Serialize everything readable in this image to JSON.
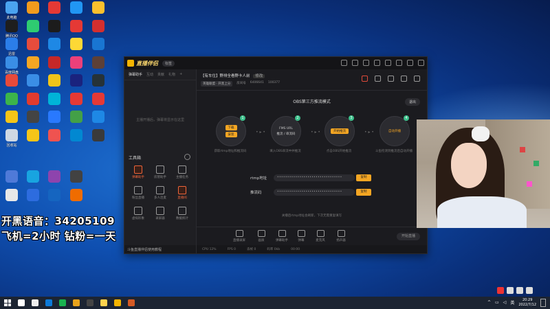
{
  "desktop": {
    "icons": [
      {
        "label": "此电脑",
        "color": "#4aa3f0"
      },
      {
        "label": "腾讯QQ",
        "color": "#1e1e1e"
      },
      {
        "label": "迅雷",
        "color": "#2b7de9"
      },
      {
        "label": "百度网盘",
        "color": "#3a8ee6"
      },
      {
        "label": "",
        "color": "#e84a3a"
      },
      {
        "label": "",
        "color": "#3cb44b"
      },
      {
        "label": "",
        "color": "#f5c518"
      },
      {
        "label": "回收站",
        "color": "#cfd8e3"
      },
      {
        "label": "",
        "color": "#4f7ad8"
      },
      {
        "label": "",
        "color": "#e8e8e8"
      },
      {
        "label": "",
        "color": "#f29b1d"
      },
      {
        "label": "",
        "color": "#2ecc71"
      },
      {
        "label": "",
        "color": "#e74c3c"
      },
      {
        "label": "",
        "color": "#f5a623"
      },
      {
        "label": "",
        "color": "#3a8ee6"
      },
      {
        "label": "",
        "color": "#e23b2e"
      },
      {
        "label": "",
        "color": "#444"
      },
      {
        "label": "",
        "color": "#f5c518"
      },
      {
        "label": "",
        "color": "#18a4e0"
      },
      {
        "label": "",
        "color": "#2d6cdf"
      },
      {
        "label": "",
        "color": "#e53935"
      },
      {
        "label": "",
        "color": "#1c1c1c"
      },
      {
        "label": "",
        "color": "#1e88e5"
      },
      {
        "label": "",
        "color": "#c62828"
      },
      {
        "label": "",
        "color": "#f0c419"
      },
      {
        "label": "",
        "color": "#00b4d8"
      },
      {
        "label": "",
        "color": "#2979ff"
      },
      {
        "label": "",
        "color": "#ef5350"
      },
      {
        "label": "",
        "color": "#8e44ad"
      },
      {
        "label": "",
        "color": "#1565c0"
      },
      {
        "label": "",
        "color": "#2196f3"
      },
      {
        "label": "",
        "color": "#e53935"
      },
      {
        "label": "",
        "color": "#fdd835"
      },
      {
        "label": "",
        "color": "#ec407a"
      },
      {
        "label": "",
        "color": "#1a237e"
      },
      {
        "label": "",
        "color": "#e53935"
      },
      {
        "label": "",
        "color": "#43a047"
      },
      {
        "label": "",
        "color": "#0288d1"
      },
      {
        "label": "",
        "color": "#424242"
      },
      {
        "label": "",
        "color": "#ef6c00"
      },
      {
        "label": "",
        "color": "#fbc02d"
      },
      {
        "label": "",
        "color": "#d32f2f"
      },
      {
        "label": "",
        "color": "#1976d2"
      },
      {
        "label": "",
        "color": "#5d4037"
      },
      {
        "label": "",
        "color": "#263238"
      },
      {
        "label": "",
        "color": "#e53935"
      },
      {
        "label": "",
        "color": "#1e88e5"
      },
      {
        "label": "",
        "color": "#3a3a3a"
      }
    ]
  },
  "overlay": {
    "line1": "开黑语音：34205109",
    "line2": "飞机=2小时 钻粉=一天"
  },
  "window": {
    "app_name": "直播伴侣",
    "version": "标签",
    "left_tabs": [
      "弹幕助手",
      "互动",
      "贡献",
      "礼物",
      "+"
    ],
    "left_hint": "主播开播后，弹幕将显示在这里",
    "tools_title": "工具箱",
    "tools": [
      {
        "label": "弹幕助手",
        "orange": true
      },
      {
        "label": "房管助手",
        "orange": false
      },
      {
        "label": "主播任务",
        "orange": false
      },
      {
        "label": "粉丝直播",
        "orange": false
      },
      {
        "label": "多人连麦",
        "orange": false
      },
      {
        "label": "直播闹",
        "orange": true
      },
      {
        "label": "虚拟形象",
        "orange": false
      },
      {
        "label": "录屏器",
        "orange": false
      },
      {
        "label": "数据统计",
        "orange": false
      }
    ],
    "footer": "斗鱼直播伴侣使用教程",
    "room": {
      "title": "【有车位】野排全看野卡人前",
      "tag": "修改",
      "category": "英雄联盟 · 开黑上分",
      "room_label": "房间号",
      "room_id": "6406641",
      "hot": "100377"
    },
    "mode_title": "OBS第三方推流模式",
    "exit": "退出",
    "steps": [
      {
        "num": "1",
        "btns": [
          "下载",
          "安装"
        ],
        "desc": "获取rtmp地址和推流码"
      },
      {
        "num": "2",
        "lines": [
          "FMS URL",
          "推流 / 串流码"
        ],
        "desc": "填入OBS串流中并推流"
      },
      {
        "num": "3",
        "lines": [
          "开始推流"
        ],
        "desc": "点击OBS开始推流"
      },
      {
        "num": "4",
        "lines": [
          "自动开播"
        ],
        "desc": "斗鱼检测到推流后自动开播"
      }
    ],
    "rtmp_label": "rtmp地址",
    "rtmp_value": "••••••••••••••••••••••••••••••••",
    "stream_label": "推流码",
    "stream_value": "••••••••••••••••••••••••••••••••",
    "copy_label": "复制",
    "hint": "关播后rtmp地址会刷新，下次无需重复填写",
    "bottom_tools": [
      "直播录屏",
      "画质",
      "弹幕助手",
      "弹幕",
      "麦克风",
      "扬声器"
    ],
    "start_label": "开始直播",
    "status": [
      "CPU 12%",
      "FPS 0",
      "丢帧 0",
      "码率 0kb",
      "00:00"
    ]
  },
  "taskbar": {
    "time": "20:29",
    "date": "2022/7/12",
    "tray": "英",
    "apps": [
      "#ffffff",
      "#eeeeee",
      "#0d7ad8",
      "#18b24f",
      "#e8a31c",
      "#444",
      "#ffd34e",
      "#f5b400",
      "#d45a24"
    ]
  }
}
